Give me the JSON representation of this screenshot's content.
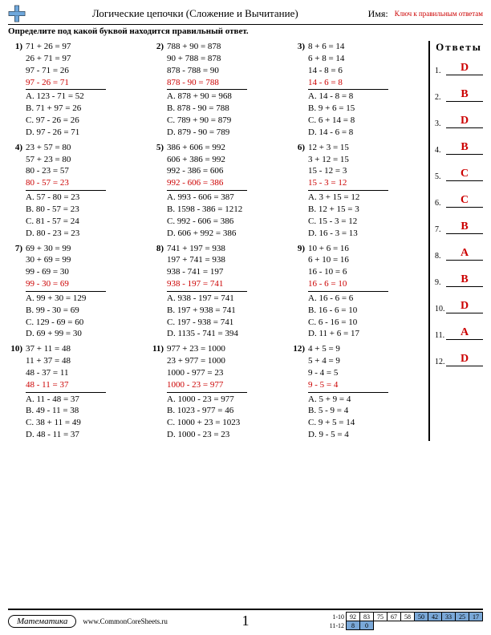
{
  "header": {
    "title": "Логические цепочки (Сложение и Вычитание)",
    "name_label": "Имя:",
    "key_label": "Ключ к правильным ответам"
  },
  "instruction": "Определите под какой буквой находится правильный ответ.",
  "answers_title": "Ответы",
  "problems": [
    {
      "n": "1)",
      "lines": [
        "71 + 26 = 97",
        "26 + 71 = 97",
        "97 - 71 = 26"
      ],
      "red": "97 - 26 = 71",
      "opts": [
        "A. 123 - 71 = 52",
        "B. 71 + 97 = 26",
        "C. 97 - 26 = 26",
        "D. 97 - 26 = 71"
      ]
    },
    {
      "n": "2)",
      "lines": [
        "788 + 90 = 878",
        "90 + 788 = 878",
        "878 - 788 = 90"
      ],
      "red": "878 - 90 = 788",
      "opts": [
        "A. 878 + 90 = 968",
        "B. 878 - 90 = 788",
        "C. 789 + 90 = 879",
        "D. 879 - 90 = 789"
      ]
    },
    {
      "n": "3)",
      "lines": [
        "8 + 6 = 14",
        "6 + 8 = 14",
        "14 - 8 = 6"
      ],
      "red": "14 - 6 = 8",
      "opts": [
        "A. 14 - 8 = 8",
        "B. 9 + 6 = 15",
        "C. 6 + 14 = 8",
        "D. 14 - 6 = 8"
      ]
    },
    {
      "n": "4)",
      "lines": [
        "23 + 57 = 80",
        "57 + 23 = 80",
        "80 - 23 = 57"
      ],
      "red": "80 - 57 = 23",
      "opts": [
        "A. 57 - 80 = 23",
        "B. 80 - 57 = 23",
        "C. 81 - 57 = 24",
        "D. 80 - 23 = 23"
      ]
    },
    {
      "n": "5)",
      "lines": [
        "386 + 606 = 992",
        "606 + 386 = 992",
        "992 - 386 = 606"
      ],
      "red": "992 - 606 = 386",
      "opts": [
        "A. 993 - 606 = 387",
        "B. 1598 - 386 = 1212",
        "C. 992 - 606 = 386",
        "D. 606 + 992 = 386"
      ]
    },
    {
      "n": "6)",
      "lines": [
        "12 + 3 = 15",
        "3 + 12 = 15",
        "15 - 12 = 3"
      ],
      "red": "15 - 3 = 12",
      "opts": [
        "A. 3 + 15 = 12",
        "B. 12 + 15 = 3",
        "C. 15 - 3 = 12",
        "D. 16 - 3 = 13"
      ]
    },
    {
      "n": "7)",
      "lines": [
        "69 + 30 = 99",
        "30 + 69 = 99",
        "99 - 69 = 30"
      ],
      "red": "99 - 30 = 69",
      "opts": [
        "A. 99 + 30 = 129",
        "B. 99 - 30 = 69",
        "C. 129 - 69 = 60",
        "D. 69 + 99 = 30"
      ]
    },
    {
      "n": "8)",
      "lines": [
        "741 + 197 = 938",
        "197 + 741 = 938",
        "938 - 741 = 197"
      ],
      "red": "938 - 197 = 741",
      "opts": [
        "A. 938 - 197 = 741",
        "B. 197 + 938 = 741",
        "C. 197 - 938 = 741",
        "D. 1135 - 741 = 394"
      ]
    },
    {
      "n": "9)",
      "lines": [
        "10 + 6 = 16",
        "6 + 10 = 16",
        "16 - 10 = 6"
      ],
      "red": "16 - 6 = 10",
      "opts": [
        "A. 16 - 6 = 6",
        "B. 16 - 6 = 10",
        "C. 6 - 16 = 10",
        "D. 11 + 6 = 17"
      ]
    },
    {
      "n": "10)",
      "lines": [
        "37 + 11 = 48",
        "11 + 37 = 48",
        "48 - 37 = 11"
      ],
      "red": "48 - 11 = 37",
      "opts": [
        "A. 11 - 48 = 37",
        "B. 49 - 11 = 38",
        "C. 38 + 11 = 49",
        "D. 48 - 11 = 37"
      ]
    },
    {
      "n": "11)",
      "lines": [
        "977 + 23 = 1000",
        "23 + 977 = 1000",
        "1000 - 977 = 23"
      ],
      "red": "1000 - 23 = 977",
      "opts": [
        "A. 1000 - 23 = 977",
        "B. 1023 - 977 = 46",
        "C. 1000 + 23 = 1023",
        "D. 1000 - 23 = 23"
      ]
    },
    {
      "n": "12)",
      "lines": [
        "4 + 5 = 9",
        "5 + 4 = 9",
        "9 - 4 = 5"
      ],
      "red": "9 - 5 = 4",
      "opts": [
        "A. 5 + 9 = 4",
        "B. 5 - 9 = 4",
        "C. 9 + 5 = 14",
        "D. 9 - 5 = 4"
      ]
    }
  ],
  "answers": [
    "D",
    "B",
    "D",
    "B",
    "C",
    "C",
    "B",
    "A",
    "B",
    "D",
    "A",
    "D"
  ],
  "footer": {
    "subject": "Математика",
    "site": "www.CommonCoreSheets.ru",
    "page": "1",
    "row1_label": "1-10",
    "row2_label": "11-12",
    "row1": [
      "92",
      "83",
      "75",
      "67",
      "58",
      "50",
      "42",
      "33",
      "25",
      "17"
    ],
    "row2": [
      "8",
      "0"
    ]
  }
}
